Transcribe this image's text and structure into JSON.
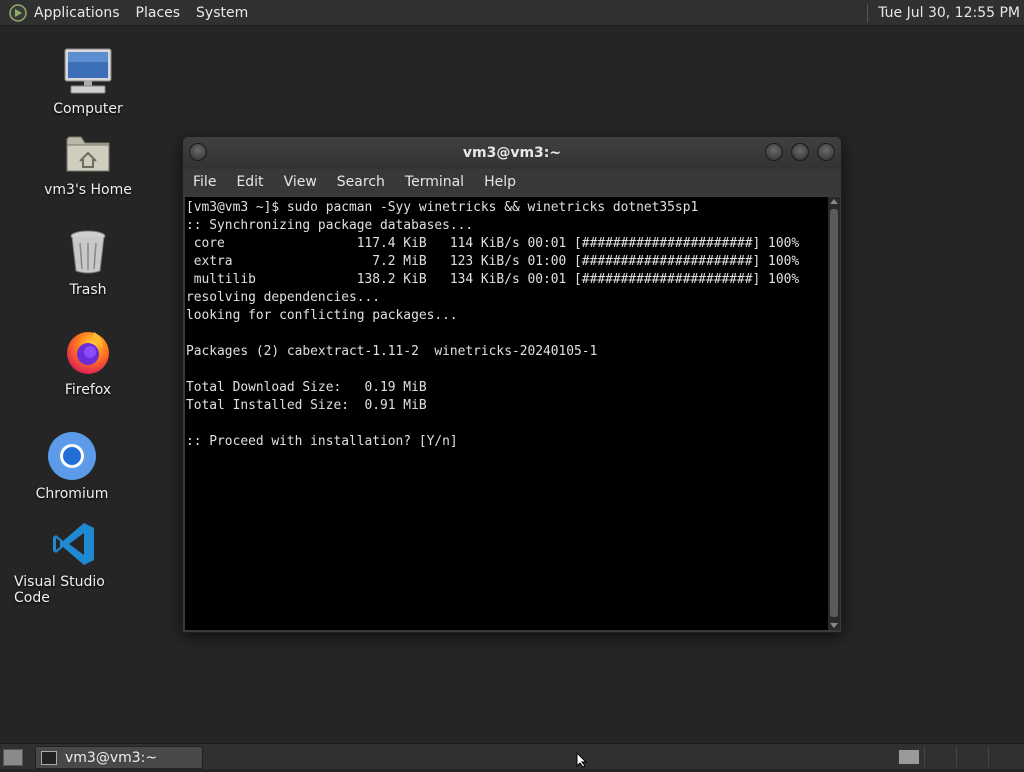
{
  "top_panel": {
    "menus": [
      "Applications",
      "Places",
      "System"
    ],
    "clock": "Tue Jul 30, 12:55 PM"
  },
  "desktop_icons": [
    {
      "label": "Computer",
      "icon": "computer-icon"
    },
    {
      "label": "vm3's Home",
      "icon": "home-folder-icon"
    },
    {
      "label": "Trash",
      "icon": "trash-icon"
    },
    {
      "label": "Firefox",
      "icon": "firefox-icon"
    },
    {
      "label": "Chromium",
      "icon": "chromium-icon"
    },
    {
      "label": "Visual Studio Code",
      "icon": "vscode-icon"
    }
  ],
  "window": {
    "title": "vm3@vm3:~",
    "menus": [
      "File",
      "Edit",
      "View",
      "Search",
      "Terminal",
      "Help"
    ],
    "terminal_lines": [
      "[vm3@vm3 ~]$ sudo pacman -Syy winetricks && winetricks dotnet35sp1",
      ":: Synchronizing package databases...",
      " core                 117.4 KiB   114 KiB/s 00:01 [######################] 100%",
      " extra                  7.2 MiB   123 KiB/s 01:00 [######################] 100%",
      " multilib             138.2 KiB   134 KiB/s 00:01 [######################] 100%",
      "resolving dependencies...",
      "looking for conflicting packages...",
      "",
      "Packages (2) cabextract-1.11-2  winetricks-20240105-1",
      "",
      "Total Download Size:   0.19 MiB",
      "Total Installed Size:  0.91 MiB",
      "",
      ":: Proceed with installation? [Y/n]"
    ]
  },
  "taskbar": {
    "task_label": "vm3@vm3:~"
  }
}
